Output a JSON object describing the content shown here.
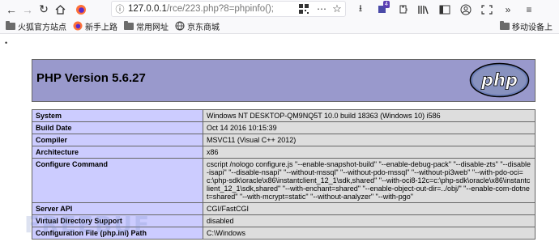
{
  "browser": {
    "url_host": "127.0.0.1",
    "url_path": "/rce/223.php?8=phpinfo();",
    "extension_badge": "4"
  },
  "bookmarks": [
    {
      "label": "火狐官方站点",
      "icon": "firefox-icon"
    },
    {
      "label": "新手上路",
      "icon": "firefox-icon"
    },
    {
      "label": "常用网址",
      "icon": "folder-icon"
    },
    {
      "label": "京东商城",
      "icon": "globe-icon"
    }
  ],
  "bookmarks_right": {
    "label": "移动设备上"
  },
  "page": {
    "stray_mark": "•",
    "php_title": "PHP Version 5.6.27",
    "logo_text": "php",
    "rows": [
      {
        "key": "System",
        "value": "Windows NT DESKTOP-QM9NQ5T 10.0 build 18363 (Windows 10) i586"
      },
      {
        "key": "Build Date",
        "value": "Oct 14 2016 10:15:39"
      },
      {
        "key": "Compiler",
        "value": "MSVC11 (Visual C++ 2012)"
      },
      {
        "key": "Architecture",
        "value": "x86"
      },
      {
        "key": "Configure Command",
        "value": "cscript /nologo configure.js \"--enable-snapshot-build\" \"--enable-debug-pack\" \"--disable-zts\" \"--disable-isapi\" \"--disable-nsapi\" \"--without-mssql\" \"--without-pdo-mssql\" \"--without-pi3web\" \"--with-pdo-oci=c:\\php-sdk\\oracle\\x86\\instantclient_12_1\\sdk,shared\" \"--with-oci8-12c=c:\\php-sdk\\oracle\\x86\\instantclient_12_1\\sdk,shared\" \"--with-enchant=shared\" \"--enable-object-out-dir=../obj/\" \"--enable-com-dotnet=shared\" \"--with-mcrypt=static\" \"--without-analyzer\" \"--with-pgo\""
      },
      {
        "key": "Server API",
        "value": "CGI/FastCGI"
      },
      {
        "key": "Virtual Directory Support",
        "value": "disabled"
      },
      {
        "key": "Configuration File (php.ini) Path",
        "value": "C:\\Windows"
      }
    ]
  },
  "watermark": "FREEBUF"
}
